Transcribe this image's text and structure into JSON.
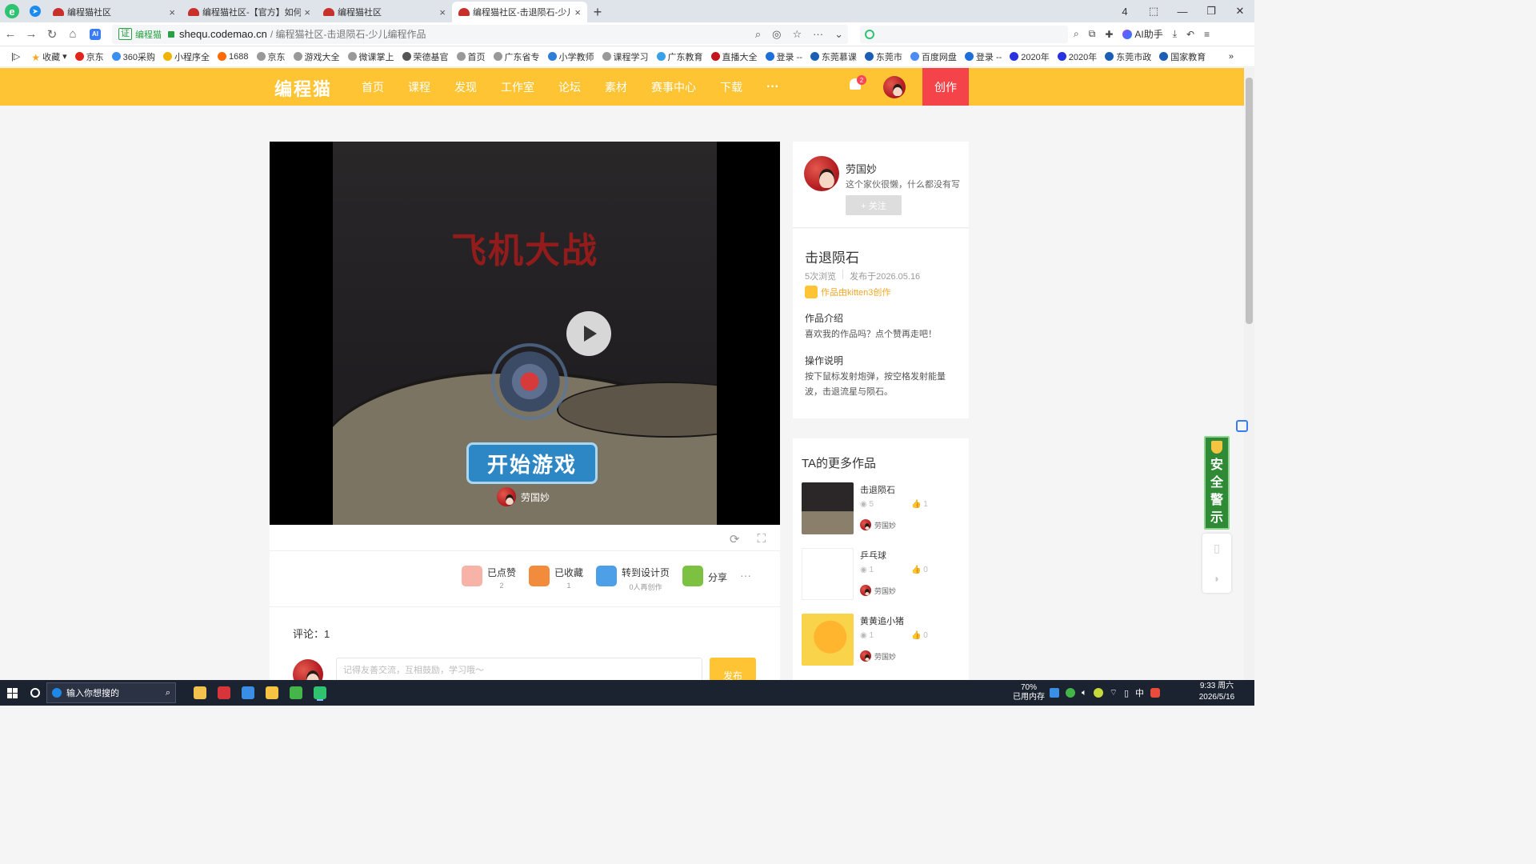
{
  "browser": {
    "tabs": [
      {
        "title": "编程猫社区"
      },
      {
        "title": "编程猫社区-【官方】如何上"
      },
      {
        "title": "编程猫社区"
      },
      {
        "title": "编程猫社区-击退陨石-少儿编"
      }
    ],
    "tab_count_badge": "4",
    "cert_label": "证",
    "cert_text": "编程猫",
    "url_host": "shequ.codemao.cn",
    "url_title": "/ 编程猫社区-击退陨石-少儿编程作品",
    "ai_helper": "AI助手",
    "bookmarks": [
      "收藏",
      "京东",
      "360采购",
      "小程序全",
      "1688",
      "京东",
      "游戏大全",
      "微课掌上",
      "荣德基官",
      "首页",
      "广东省专",
      "小学教师",
      "课程学习",
      "广东教育",
      "直播大全",
      "登录 --",
      "东莞慕课",
      "东莞市",
      "百度网盘",
      "登录 --",
      "2020年",
      "2020年",
      "东莞市政",
      "国家教育"
    ]
  },
  "site": {
    "logo": "编程猫",
    "nav": [
      "首页",
      "课程",
      "发现",
      "工作室",
      "论坛",
      "素材",
      "赛事中心",
      "下载"
    ],
    "more": "···",
    "notification_count": "2",
    "create_label": "创作",
    "accent_color": "#fec433",
    "create_color": "#f4444a"
  },
  "player": {
    "game_title": "飞机大战",
    "start_button": "开始游戏",
    "author": "劳国妙"
  },
  "actions": [
    {
      "label": "已点赞",
      "count": "2"
    },
    {
      "label": "已收藏",
      "count": "1"
    },
    {
      "label": "转到设计页",
      "count": "0人再创作"
    },
    {
      "label": "分享",
      "count": ""
    }
  ],
  "comments": {
    "count_label": "评论：1",
    "placeholder": "记得友善交流，互相鼓励，学习哦～",
    "post_button": "发布"
  },
  "author_card": {
    "name": "劳国妙",
    "bio": "这个家伙很懒，什么都没有写",
    "follow_button": "+ 关注"
  },
  "work": {
    "title": "击退陨石",
    "views": "5次浏览",
    "published": "发布于2026.05.16",
    "made_with": "作品由kitten3创作",
    "intro_heading": "作品介绍",
    "intro_text": "喜欢我的作品吗？点个赞再走吧！",
    "howto_heading": "操作说明",
    "howto_text": "按下鼠标发射炮弹，按空格发射能量波，击退流星与陨石。"
  },
  "more_works": {
    "title": "TA的更多作品",
    "items": [
      {
        "name": "击退陨石",
        "views": "5",
        "likes": "1",
        "author": "劳国妙"
      },
      {
        "name": "乒乓球",
        "views": "1",
        "likes": "0",
        "author": "劳国妙"
      },
      {
        "name": "黄黄追小猪",
        "views": "1",
        "likes": "0",
        "author": "劳国妙"
      }
    ]
  },
  "safety_widget": [
    "安",
    "全",
    "警",
    "示"
  ],
  "taskbar": {
    "search_placeholder": "输入你想搜的",
    "memory_percent": "70%",
    "memory_label": "已用内存",
    "ime": "中",
    "time": "9:33 周六",
    "date": "2026/5/16"
  }
}
